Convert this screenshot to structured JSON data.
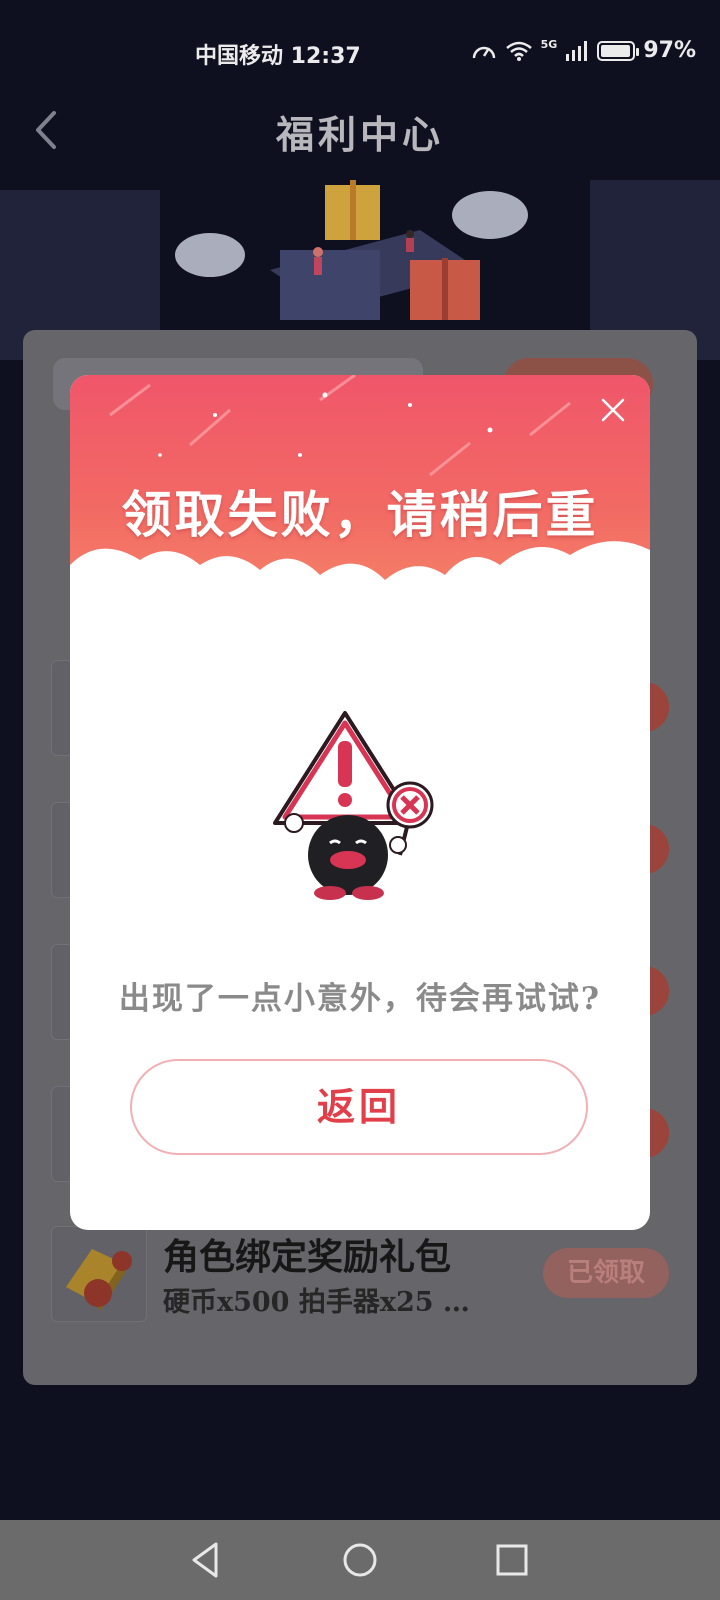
{
  "status_bar": {
    "carrier_time": "中国移动 12:37",
    "network": "5G",
    "battery_percent": "97%",
    "battery_level": 0.97,
    "icons": [
      "speed-icon",
      "wifi-icon",
      "signal-icon",
      "battery-icon"
    ]
  },
  "header": {
    "title": "福利中心",
    "back_icon": "chevron-left-icon"
  },
  "background_list": {
    "last_item": {
      "title": "角色绑定奖励礼包",
      "subtitle": "硬币x500 拍手器x25 …",
      "status": "已领取"
    }
  },
  "dialog": {
    "title": "领取失败，请稍后重",
    "message": "出现了一点小意外，待会再试试?",
    "return_label": "返回",
    "close_icon": "close-icon",
    "mascot_icon": "warning-mascot-icon"
  },
  "nav_bar": {
    "icons": [
      "back-triangle-icon",
      "home-circle-icon",
      "recent-square-icon"
    ]
  },
  "colors": {
    "page_bg": "#101223",
    "dialog_gradient_top": "#f0566a",
    "dialog_gradient_bottom": "#f7956b",
    "accent_red": "#e1404a",
    "button_border": "#f3b0b4"
  }
}
